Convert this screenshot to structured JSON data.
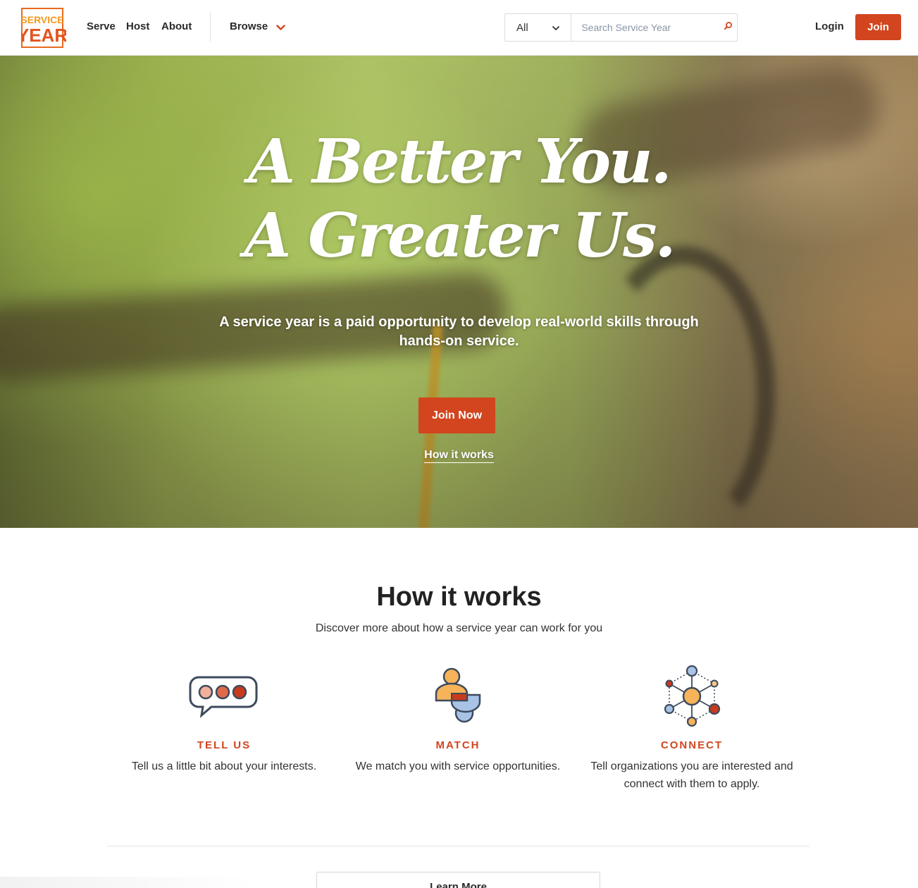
{
  "header": {
    "logo": {
      "line1": "SERVICE",
      "line2": "YEAR",
      "icon": "service-year-logo"
    },
    "nav": [
      {
        "label": "Serve"
      },
      {
        "label": "Host"
      },
      {
        "label": "About"
      }
    ],
    "browse": {
      "label": "Browse",
      "icon": "chevron-down-icon"
    },
    "search": {
      "category": "All",
      "placeholder": "Search Service Year",
      "icon": "search-icon"
    },
    "login_label": "Login",
    "join_label": "Join"
  },
  "hero": {
    "headline_line1": "A Better You.",
    "headline_line2": "A Greater Us.",
    "subtitle": "A service year is a paid opportunity to develop real-world skills through hands-on service.",
    "cta_label": "Join Now",
    "secondary_link": "How it works"
  },
  "how_it_works": {
    "title": "How it works",
    "subtitle": "Discover more about how a service year can work for you",
    "steps": [
      {
        "label": "TELL US",
        "description": "Tell us a little bit about your interests.",
        "icon": "chat-bubble-icon"
      },
      {
        "label": "MATCH",
        "description": "We match you with service opportunities.",
        "icon": "match-people-icon"
      },
      {
        "label": "CONNECT",
        "description": "Tell organizations you are interested and connect with them to apply.",
        "icon": "network-icon"
      }
    ],
    "learn_more_label": "Learn More"
  },
  "colors": {
    "accent": "#d2451e",
    "logo_orange": "#f29a1f"
  }
}
